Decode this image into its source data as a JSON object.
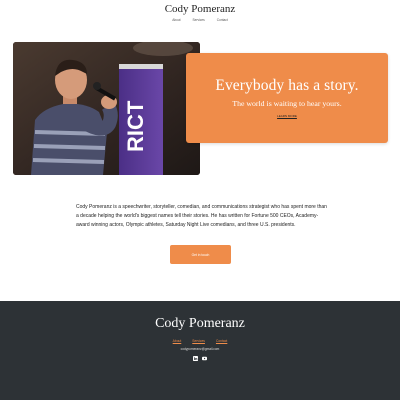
{
  "header": {
    "title": "Cody Pomeranz",
    "nav": [
      "About",
      "Services",
      "Contact"
    ]
  },
  "hero": {
    "headline": "Everybody has a story.",
    "subheadline": "The world is waiting to hear yours.",
    "link_label": "LEARN MORE",
    "banner_text": "RICT"
  },
  "bio": {
    "text": "Cody Pomeranz is a speechwriter, storyteller, comedian, and communications strategist who has spent more than a decade helping the world's biggest names tell their stories. He has written for Fortune 500 CEOs, Academy-award winning actors, Olympic athletes, Saturday Night Live comedians, and three U.S. presidents."
  },
  "cta": {
    "label": "Get in touch"
  },
  "footer": {
    "title": "Cody Pomeranz",
    "nav": [
      "About",
      "Services",
      "Contact"
    ],
    "email": "codypomeranz@gmail.com",
    "social": [
      "linkedin-icon",
      "youtube-icon"
    ]
  },
  "colors": {
    "accent": "#ef8c4a",
    "footer_bg": "#2d3236"
  }
}
